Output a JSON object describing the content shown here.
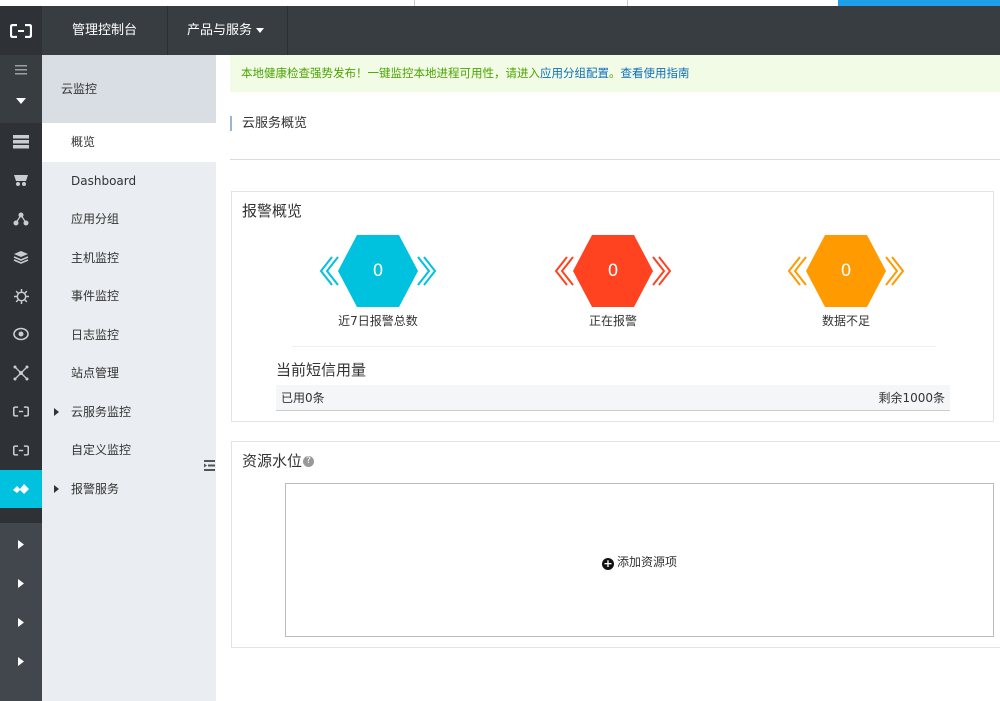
{
  "header": {
    "console_label": "管理控制台",
    "products_label": "产品与服务"
  },
  "submenu": {
    "title": "云监控",
    "items": [
      {
        "label": "概览"
      },
      {
        "label": "Dashboard"
      },
      {
        "label": "应用分组"
      },
      {
        "label": "主机监控"
      },
      {
        "label": "事件监控"
      },
      {
        "label": "日志监控"
      },
      {
        "label": "站点管理"
      },
      {
        "label": "云服务监控"
      },
      {
        "label": "自定义监控"
      },
      {
        "label": "报警服务"
      }
    ]
  },
  "notice": {
    "text": "本地健康检查强势发布！一键监控本地进程可用性，请进入",
    "link1": "应用分组配置",
    "sep": "。",
    "link2": "查看使用指南"
  },
  "page": {
    "title": "云服务概览"
  },
  "alarm": {
    "title": "报警概览",
    "stats": [
      {
        "value": "0",
        "label": "近7日报警总数",
        "color": "#00c1de"
      },
      {
        "value": "0",
        "label": "正在报警",
        "color": "#ff4220"
      },
      {
        "value": "0",
        "label": "数据不足",
        "color": "#ff9a00"
      }
    ],
    "sms": {
      "title": "当前短信用量",
      "used": "已用0条",
      "remaining": "剩余1000条"
    }
  },
  "resource": {
    "title": "资源水位",
    "help": "?",
    "add_label": "添加资源项"
  },
  "colors": {
    "header_bg": "#373d41",
    "rail_bg": "#2e3236",
    "accent": "#00c1de",
    "submenu_bg": "#eaedf1"
  }
}
